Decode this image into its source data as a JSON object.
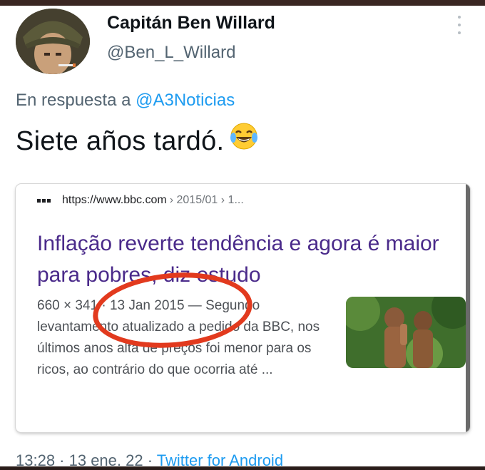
{
  "author": {
    "display_name": "Capitán Ben Willard",
    "handle": "@Ben_L_Willard"
  },
  "reply": {
    "prefix": "En respuesta a",
    "mention": "@A3Noticias"
  },
  "tweet": {
    "text": "Siete años tardó.",
    "emoji_icon": "face-with-tears-of-joy-icon"
  },
  "card": {
    "url_host": "https://www.bbc.com",
    "url_path": "› 2015/01 › 1...",
    "headline": "Inflação reverte tendência e agora é maior para pobres, diz estudo",
    "snippet": "660 × 341 · 13 Jan 2015 — Segundo levantamento atualizado a pedido da BBC, nos últimos anos alta de preços foi menor para os ricos, ao contrário do que ocorria até ..."
  },
  "footer": {
    "time": "13:28 · 13 ene. 22 · ",
    "source": "Twitter for Android"
  },
  "colors": {
    "link": "#1d9bf0",
    "headline": "#4a2a8a",
    "annotation": "#e23a1e"
  }
}
